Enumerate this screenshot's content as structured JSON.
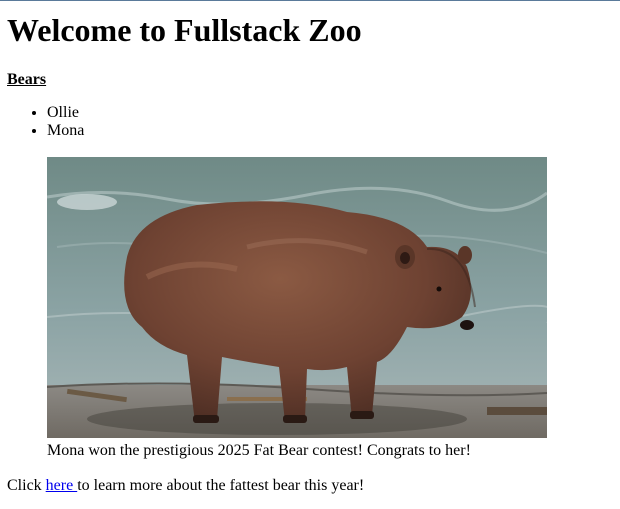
{
  "page": {
    "title": "Welcome to Fullstack Zoo",
    "section_link": "Bears",
    "bears": [
      "Ollie",
      "Mona"
    ],
    "figure": {
      "image_semantic": "brown-bear-photo",
      "caption": "Mona won the prestigious 2025 Fat Bear contest! Congrats to her!"
    },
    "footer": {
      "prefix": "Click ",
      "link_text": "here ",
      "suffix": "to learn more about the fattest bear this year!"
    }
  },
  "colors": {
    "link": "#0000ee",
    "text": "#000000",
    "background": "#ffffff"
  }
}
